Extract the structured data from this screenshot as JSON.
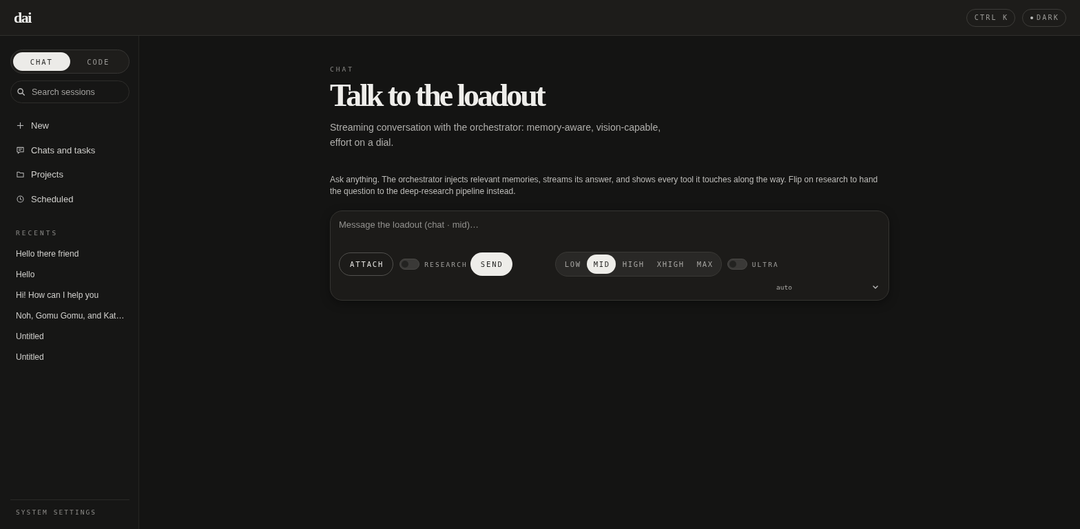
{
  "topbar": {
    "logo": "dai",
    "shortcut_button": {
      "label": "CTRL K"
    },
    "theme_button": {
      "label": "DARK"
    }
  },
  "sidebar": {
    "mode_tabs": [
      {
        "label": "CHAT",
        "selected": true
      },
      {
        "label": "CODE",
        "selected": false
      }
    ],
    "search": {
      "placeholder": "Search sessions"
    },
    "nav": [
      {
        "label": "New"
      },
      {
        "label": "Chats and tasks"
      },
      {
        "label": "Projects"
      },
      {
        "label": "Scheduled"
      }
    ],
    "recents_title": "RECENTS",
    "recents": [
      "Hello there friend",
      "Hello",
      "Hi! How can I help you",
      "Noh, Gomu Gomu, and Kat…",
      "Untitled",
      "Untitled"
    ],
    "footer_link": "SYSTEM SETTINGS"
  },
  "main": {
    "eyebrow": "CHAT",
    "title": "Talk to the loadout",
    "subtitle": "Streaming conversation with the orchestrator: memory-aware, vision-capable, effort on a dial.",
    "intro": "Ask anything. The orchestrator injects relevant memories, streams its answer, and shows every tool it touches along the way. Flip on research to hand the question to the deep-research pipeline instead.",
    "composer": {
      "placeholder": "Message the loadout (chat · mid)…",
      "attach": "ATTACH",
      "research": {
        "label": "RESEARCH",
        "on": false
      },
      "send": "SEND",
      "effort": [
        {
          "label": "LOW",
          "selected": false
        },
        {
          "label": "MID",
          "selected": true
        },
        {
          "label": "HIGH",
          "selected": false
        },
        {
          "label": "XHIGH",
          "selected": false
        },
        {
          "label": "MAX",
          "selected": false
        }
      ],
      "ultra": {
        "label": "ULTRA",
        "on": false
      },
      "model": "auto"
    }
  }
}
